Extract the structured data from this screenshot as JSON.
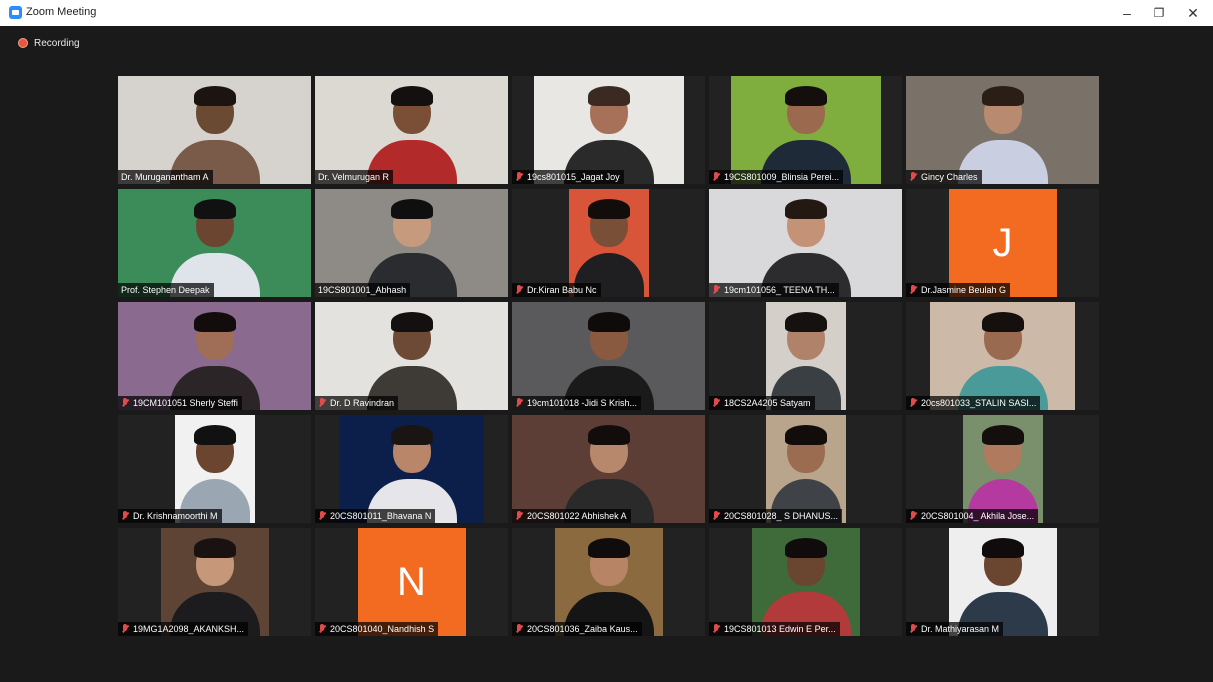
{
  "window": {
    "title": "Zoom Meeting",
    "minimize": "–",
    "maximize": "❐",
    "close": "✕"
  },
  "recording": {
    "label": "Recording",
    "color": "#e8573c"
  },
  "participants": [
    {
      "name": "Dr. Muruganantham A",
      "muted": false,
      "active": false,
      "bg": "#d6d3cf",
      "skin": "#6b4a33",
      "shirt": "#7a5a48",
      "hair": "#1b1410"
    },
    {
      "name": "Dr. Velmurugan R",
      "muted": false,
      "active": true,
      "bg": "#dcd8d2",
      "skin": "#7a4f36",
      "shirt": "#b22a2a",
      "hair": "#151010"
    },
    {
      "name": "19cs801015_Jagat Joy",
      "muted": true,
      "active": false,
      "bg": "#e9e7e4",
      "skin": "#a77058",
      "shirt": "#2a2a2a",
      "hair": "#3a2a22"
    },
    {
      "name": "19CS801009_Blinsia Perei...",
      "muted": true,
      "active": false,
      "bg": "#7fae3f",
      "skin": "#9b6a4e",
      "shirt": "#1e2a38",
      "hair": "#140f0d"
    },
    {
      "name": "Gincy Charles",
      "muted": true,
      "active": false,
      "bg": "#7a7268",
      "skin": "#b88a70",
      "shirt": "#c9cfe0",
      "hair": "#2b1e17"
    },
    {
      "name": "Prof. Stephen Deepak",
      "muted": false,
      "active": false,
      "bg": "#3c8c5a",
      "skin": "#6b4530",
      "shirt": "#dfe3ea",
      "hair": "#111"
    },
    {
      "name": "19CS801001_Abhash",
      "muted": false,
      "active": false,
      "bg": "#8e8a86",
      "skin": "#c59a7d",
      "shirt": "#2a2c30",
      "hair": "#0f0f10"
    },
    {
      "name": "Dr.Kiran Babu Nc",
      "muted": true,
      "active": false,
      "bg": "#d8553a",
      "skin": "#7a4f38",
      "shirt": "#1f1f22",
      "hair": "#120d0b"
    },
    {
      "name": "19cm101056_ TEENA TH...",
      "muted": true,
      "active": false,
      "bg": "#d9d9db",
      "skin": "#c49276",
      "shirt": "#2c2c2e",
      "hair": "#241813"
    },
    {
      "name": "Dr.Jasmine Beulah G",
      "muted": true,
      "active": false,
      "avatar": "J"
    },
    {
      "name": "19CM101051 Sherly Steffi",
      "muted": true,
      "active": false,
      "bg": "#8a6a8f",
      "skin": "#a06e57",
      "shirt": "#2b2527",
      "hair": "#120d0c"
    },
    {
      "name": "Dr. D Ravindran",
      "muted": true,
      "active": false,
      "bg": "#e4e2df",
      "skin": "#6c4a36",
      "shirt": "#3e3a35",
      "hair": "#151010"
    },
    {
      "name": "19cm101018 -Jidi S Krish...",
      "muted": true,
      "active": false,
      "bg": "#5a5a5c",
      "skin": "#8a5a40",
      "shirt": "#1a1a1a",
      "hair": "#0e0b0a"
    },
    {
      "name": "18CS2A4205 Satyam",
      "muted": true,
      "active": false,
      "bg": "#d4cfc9",
      "skin": "#b0826a",
      "shirt": "#3a3f44",
      "hair": "#15110f"
    },
    {
      "name": "20cs801033_STALIN SASI...",
      "muted": true,
      "active": false,
      "bg": "#cdb9a7",
      "skin": "#9a6a50",
      "shirt": "#4a9a9a",
      "hair": "#15100e"
    },
    {
      "name": "Dr. Krishnamoorthi M",
      "muted": true,
      "active": false,
      "bg": "#f1f1f1",
      "skin": "#6b4530",
      "shirt": "#9aa7b3",
      "hair": "#111"
    },
    {
      "name": "20CS801011_Bhavana N",
      "muted": true,
      "active": false,
      "bg": "#0b1f4a",
      "skin": "#b9866a",
      "shirt": "#e6e6ea",
      "hair": "#1a1412"
    },
    {
      "name": "20CS801022 Abhishek A",
      "muted": true,
      "active": false,
      "bg": "#5c3e36",
      "skin": "#b8886c",
      "shirt": "#2a2a2a",
      "hair": "#120d0b"
    },
    {
      "name": "20CS801028_ S DHANUS...",
      "muted": true,
      "active": false,
      "bg": "#b9a58c",
      "skin": "#9c6c50",
      "shirt": "#3f4348",
      "hair": "#120d0b"
    },
    {
      "name": "20CS801004_ Akhila Jose...",
      "muted": true,
      "active": false,
      "bg": "#7a8f6c",
      "skin": "#b07a5e",
      "shirt": "#b43aa0",
      "hair": "#140f0d"
    },
    {
      "name": "19MG1A2098_AKANKSH...",
      "muted": true,
      "active": false,
      "bg": "#5e4434",
      "skin": "#c79779",
      "shirt": "#1c1b1d",
      "hair": "#1a1210"
    },
    {
      "name": "20CS801040_Nandhish S",
      "muted": true,
      "active": false,
      "avatar": "N"
    },
    {
      "name": "20CS801036_Zaiba Kaus...",
      "muted": true,
      "active": false,
      "bg": "#8a6a3e",
      "skin": "#b88466",
      "shirt": "#151515",
      "hair": "#0f0c0b"
    },
    {
      "name": "19CS801013 Edwin E Per...",
      "muted": true,
      "active": false,
      "bg": "#3f6a3a",
      "skin": "#6a4530",
      "shirt": "#b23a3a",
      "hair": "#0f0c0b"
    },
    {
      "name": "Dr. Mathiyarasan M",
      "muted": true,
      "active": false,
      "bg": "#eeeeee",
      "skin": "#6a4530",
      "shirt": "#2c3a4a",
      "hair": "#0f0c0b"
    }
  ]
}
